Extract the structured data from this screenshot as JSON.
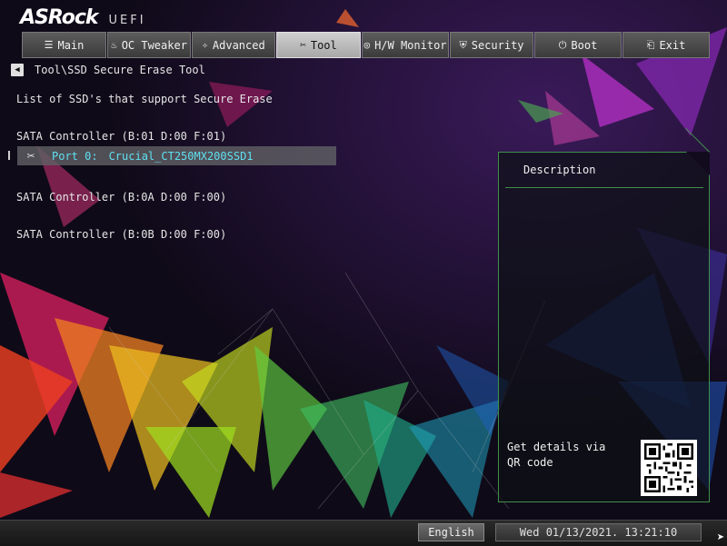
{
  "brand": {
    "name": "ASRock",
    "product": "UEFI"
  },
  "tabs": [
    {
      "label": "Main",
      "icon": "list-icon",
      "glyph": "☰"
    },
    {
      "label": "OC Tweaker",
      "icon": "tweaker-icon",
      "glyph": "♨"
    },
    {
      "label": "Advanced",
      "icon": "advanced-icon",
      "glyph": "✧"
    },
    {
      "label": "Tool",
      "icon": "tool-icon",
      "glyph": "✂"
    },
    {
      "label": "H/W Monitor",
      "icon": "monitor-icon",
      "glyph": "◎"
    },
    {
      "label": "Security",
      "icon": "shield-icon",
      "glyph": "⛨"
    },
    {
      "label": "Boot",
      "icon": "power-icon",
      "glyph": "⏻"
    },
    {
      "label": "Exit",
      "icon": "exit-icon",
      "glyph": "⎗"
    }
  ],
  "active_tab": "Tool",
  "breadcrumb": {
    "path": "Tool\\SSD Secure Erase Tool"
  },
  "content": {
    "heading": "List of SSD's that support Secure Erase",
    "controllers": [
      {
        "label": "SATA Controller (B:01 D:00 F:01)"
      },
      {
        "label": "SATA Controller (B:0A D:00 F:00)"
      },
      {
        "label": "SATA Controller (B:0B D:00 F:00)"
      }
    ],
    "selected_port": {
      "label": "Port 0:",
      "model": "Crucial_CT250MX200SSD1"
    }
  },
  "description": {
    "title": "Description",
    "qr_text": "Get details via QR code"
  },
  "status_bar": {
    "language": "English",
    "datetime": "Wed 01/13/2021. 13:21:10"
  },
  "colors": {
    "accent_cyan": "#5fe0f0",
    "panel_border": "#3f8f4a",
    "active_tab": "#c0c0c0"
  }
}
